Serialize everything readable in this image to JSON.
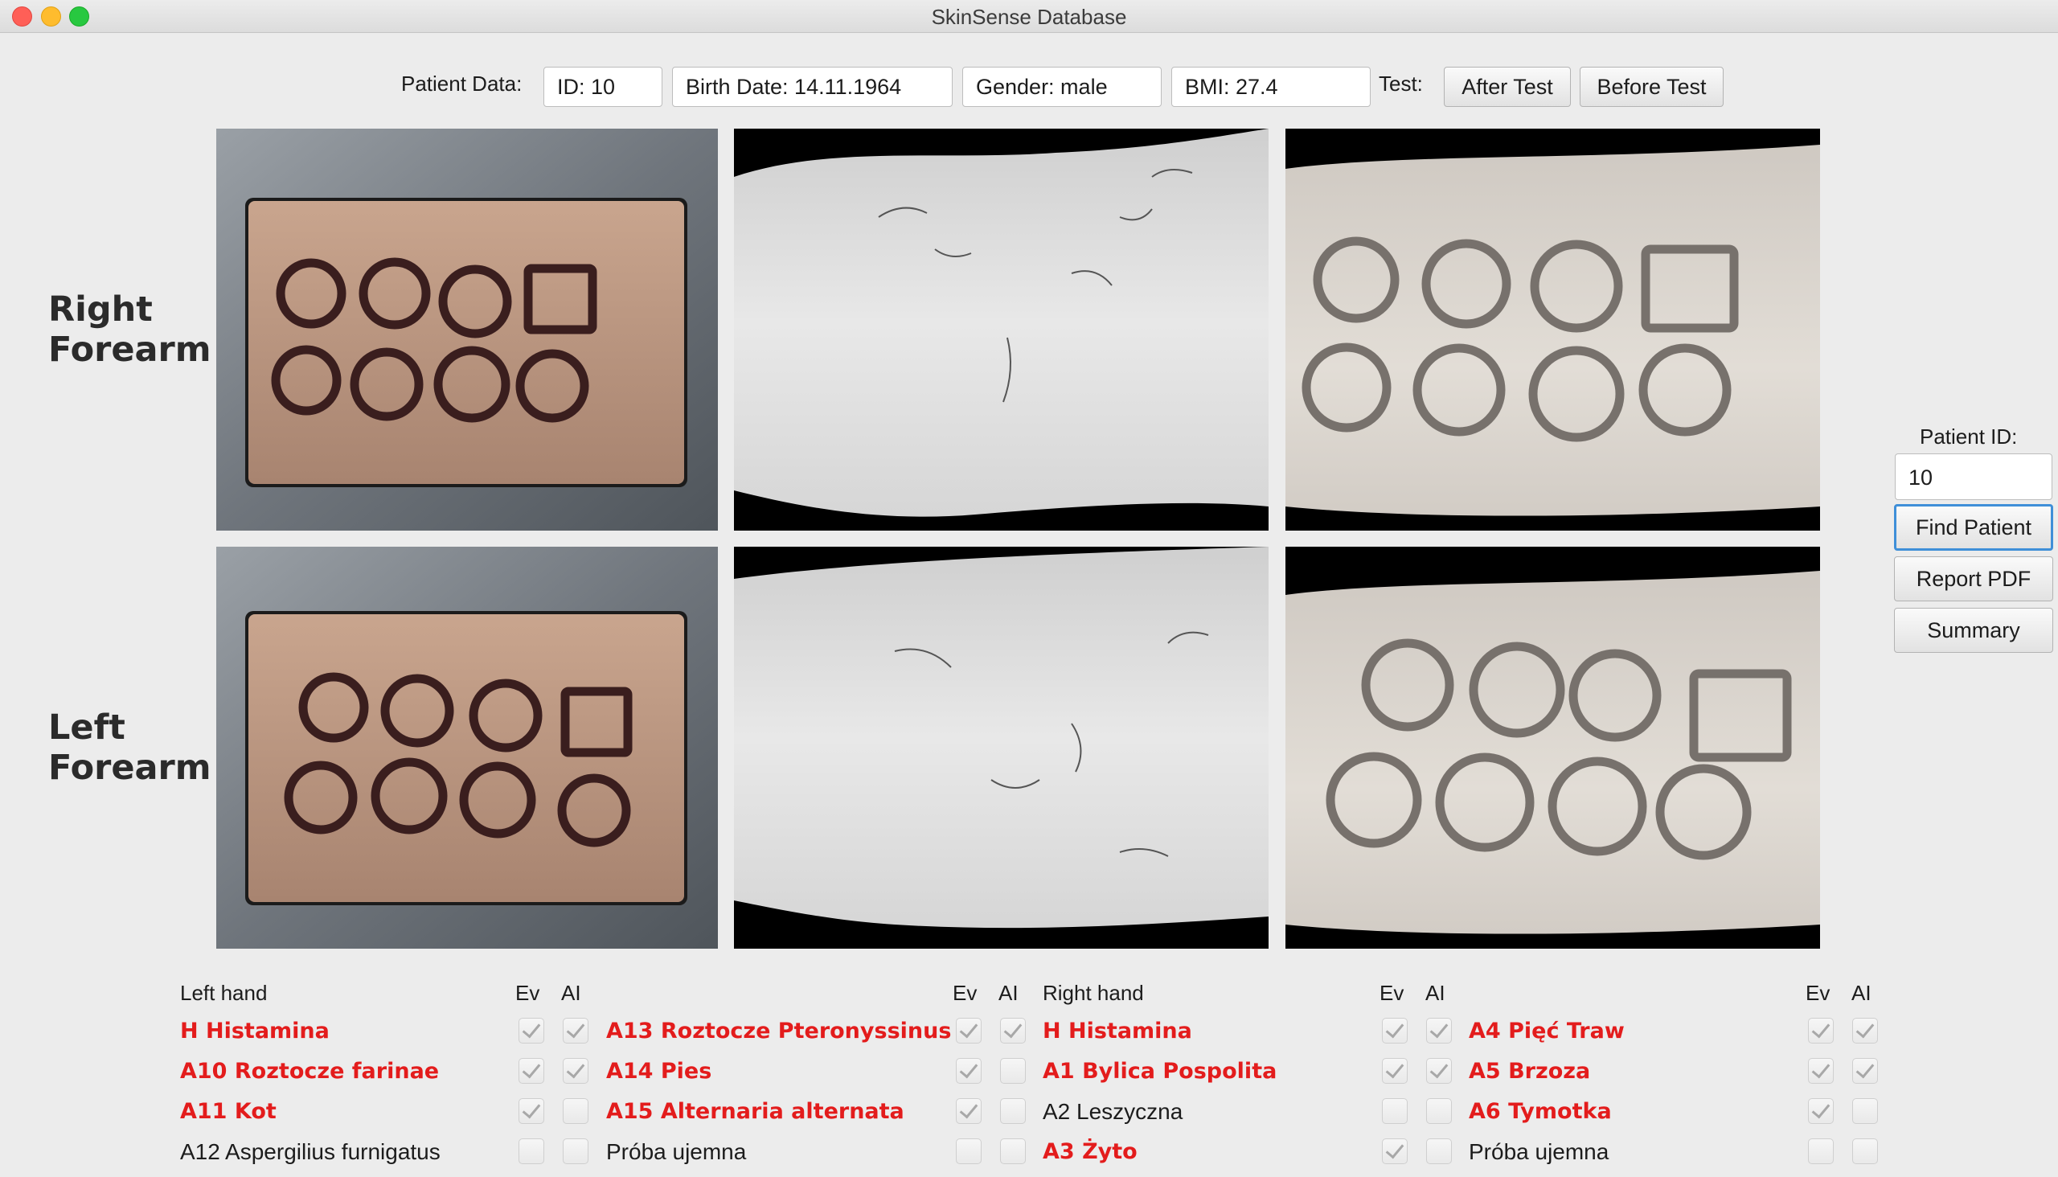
{
  "window": {
    "title": "SkinSense Database"
  },
  "patient_bar": {
    "label": "Patient Data:",
    "id": "ID: 10",
    "birth_date": "Birth Date: 14.11.1964",
    "gender": "Gender: male",
    "bmi": "BMI: 27.4",
    "test_label": "Test:",
    "after_test": "After Test",
    "before_test": "Before Test"
  },
  "side_panel": {
    "patient_id_label": "Patient ID:",
    "patient_id_value": "10",
    "find_patient": "Find Patient",
    "report_pdf": "Report PDF",
    "summary": "Summary"
  },
  "rows": {
    "right": {
      "line1": "Right",
      "line2": "Forearm"
    },
    "left": {
      "line1": "Left",
      "line2": "Forearm"
    }
  },
  "table": {
    "left_hand_header": "Left hand",
    "right_hand_header": "Right hand",
    "ev": "Ev",
    "ai": "AI",
    "columns": [
      {
        "items": [
          {
            "label": "H Histamina",
            "positive": true,
            "ev": true,
            "ai": true
          },
          {
            "label": "A10 Roztocze farinae",
            "positive": true,
            "ev": true,
            "ai": true
          },
          {
            "label": "A11 Kot",
            "positive": true,
            "ev": true,
            "ai": false
          },
          {
            "label": "A12 Aspergilius furnigatus",
            "positive": false,
            "ev": false,
            "ai": false
          }
        ]
      },
      {
        "items": [
          {
            "label": "A13 Roztocze Pteronyssinus",
            "positive": true,
            "ev": true,
            "ai": true
          },
          {
            "label": "A14 Pies",
            "positive": true,
            "ev": true,
            "ai": false
          },
          {
            "label": "A15 Alternaria alternata",
            "positive": true,
            "ev": true,
            "ai": false
          },
          {
            "label": "Próba ujemna",
            "positive": false,
            "ev": false,
            "ai": false
          }
        ]
      },
      {
        "items": [
          {
            "label": "H Histamina",
            "positive": true,
            "ev": true,
            "ai": true
          },
          {
            "label": "A1 Bylica Pospolita",
            "positive": true,
            "ev": true,
            "ai": true
          },
          {
            "label": "A2 Leszyczna",
            "positive": false,
            "ev": false,
            "ai": false
          },
          {
            "label": "A3 Żyto",
            "positive": true,
            "ev": true,
            "ai": false
          }
        ]
      },
      {
        "items": [
          {
            "label": "A4 Pięć Traw",
            "positive": true,
            "ev": true,
            "ai": true
          },
          {
            "label": "A5 Brzoza",
            "positive": true,
            "ev": true,
            "ai": true
          },
          {
            "label": "A6 Tymotka",
            "positive": true,
            "ev": true,
            "ai": false
          },
          {
            "label": "Próba ujemna",
            "positive": false,
            "ev": false,
            "ai": false
          }
        ]
      }
    ]
  },
  "colors": {
    "positive": "#e31c1c",
    "focus": "#3f8fd8",
    "background": "#ececec"
  }
}
